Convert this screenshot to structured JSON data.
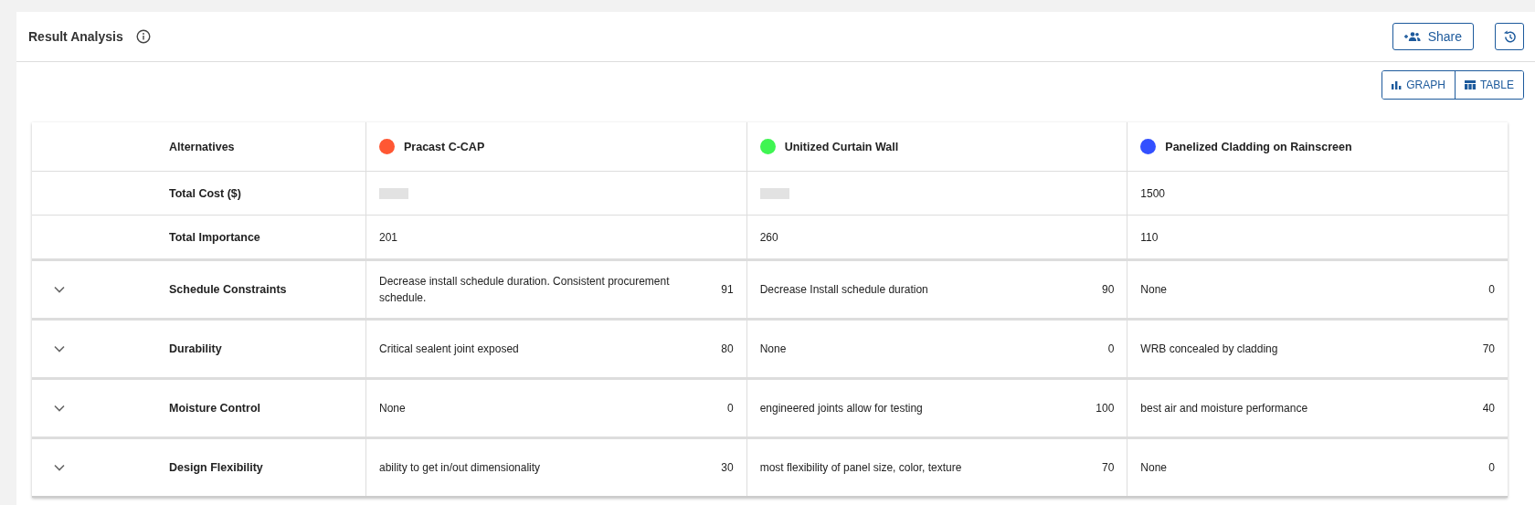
{
  "header": {
    "title": "Result Analysis",
    "share_button": "Share"
  },
  "view_toggle": [
    {
      "label": "GRAPH",
      "kind": "graph"
    },
    {
      "label": "TABLE",
      "kind": "table"
    }
  ],
  "table": {
    "corner_label": "Alternatives",
    "alternatives": [
      {
        "name": "Pracast C-CAP",
        "color": "#ff5733"
      },
      {
        "name": "Unitized Curtain Wall",
        "color": "#3ff552"
      },
      {
        "name": "Panelized Cladding on Rainscreen",
        "color": "#3350ff"
      }
    ],
    "summary_rows": [
      {
        "label": "Total Cost ($)",
        "cells": [
          {
            "redacted": true
          },
          {
            "redacted": true
          },
          {
            "redacted": false,
            "value": "1500"
          }
        ]
      },
      {
        "label": "Total Importance",
        "cells": [
          {
            "redacted": false,
            "value": "201"
          },
          {
            "redacted": false,
            "value": "260"
          },
          {
            "redacted": false,
            "value": "110"
          }
        ]
      }
    ],
    "criteria": [
      {
        "label": "Schedule Constraints",
        "expanded": false,
        "cells": [
          {
            "text": "Decrease install schedule duration. Consistent procurement schedule.",
            "score": "91"
          },
          {
            "text": "Decrease Install schedule duration",
            "score": "90"
          },
          {
            "text": "None",
            "score": "0"
          }
        ]
      },
      {
        "label": "Durability",
        "expanded": false,
        "cells": [
          {
            "text": "Critical sealent joint exposed",
            "score": "80"
          },
          {
            "text": "None",
            "score": "0"
          },
          {
            "text": "WRB concealed by cladding",
            "score": "70"
          }
        ]
      },
      {
        "label": "Moisture Control",
        "expanded": false,
        "cells": [
          {
            "text": "None",
            "score": "0"
          },
          {
            "text": "engineered joints allow for testing",
            "score": "100"
          },
          {
            "text": "best air and moisture performance",
            "score": "40"
          }
        ]
      },
      {
        "label": "Design Flexibility",
        "expanded": false,
        "cells": [
          {
            "text": "ability to get in/out dimensionality",
            "score": "30"
          },
          {
            "text": "most flexibility of panel size, color, texture",
            "score": "70"
          },
          {
            "text": "None",
            "score": "0"
          }
        ]
      }
    ]
  }
}
